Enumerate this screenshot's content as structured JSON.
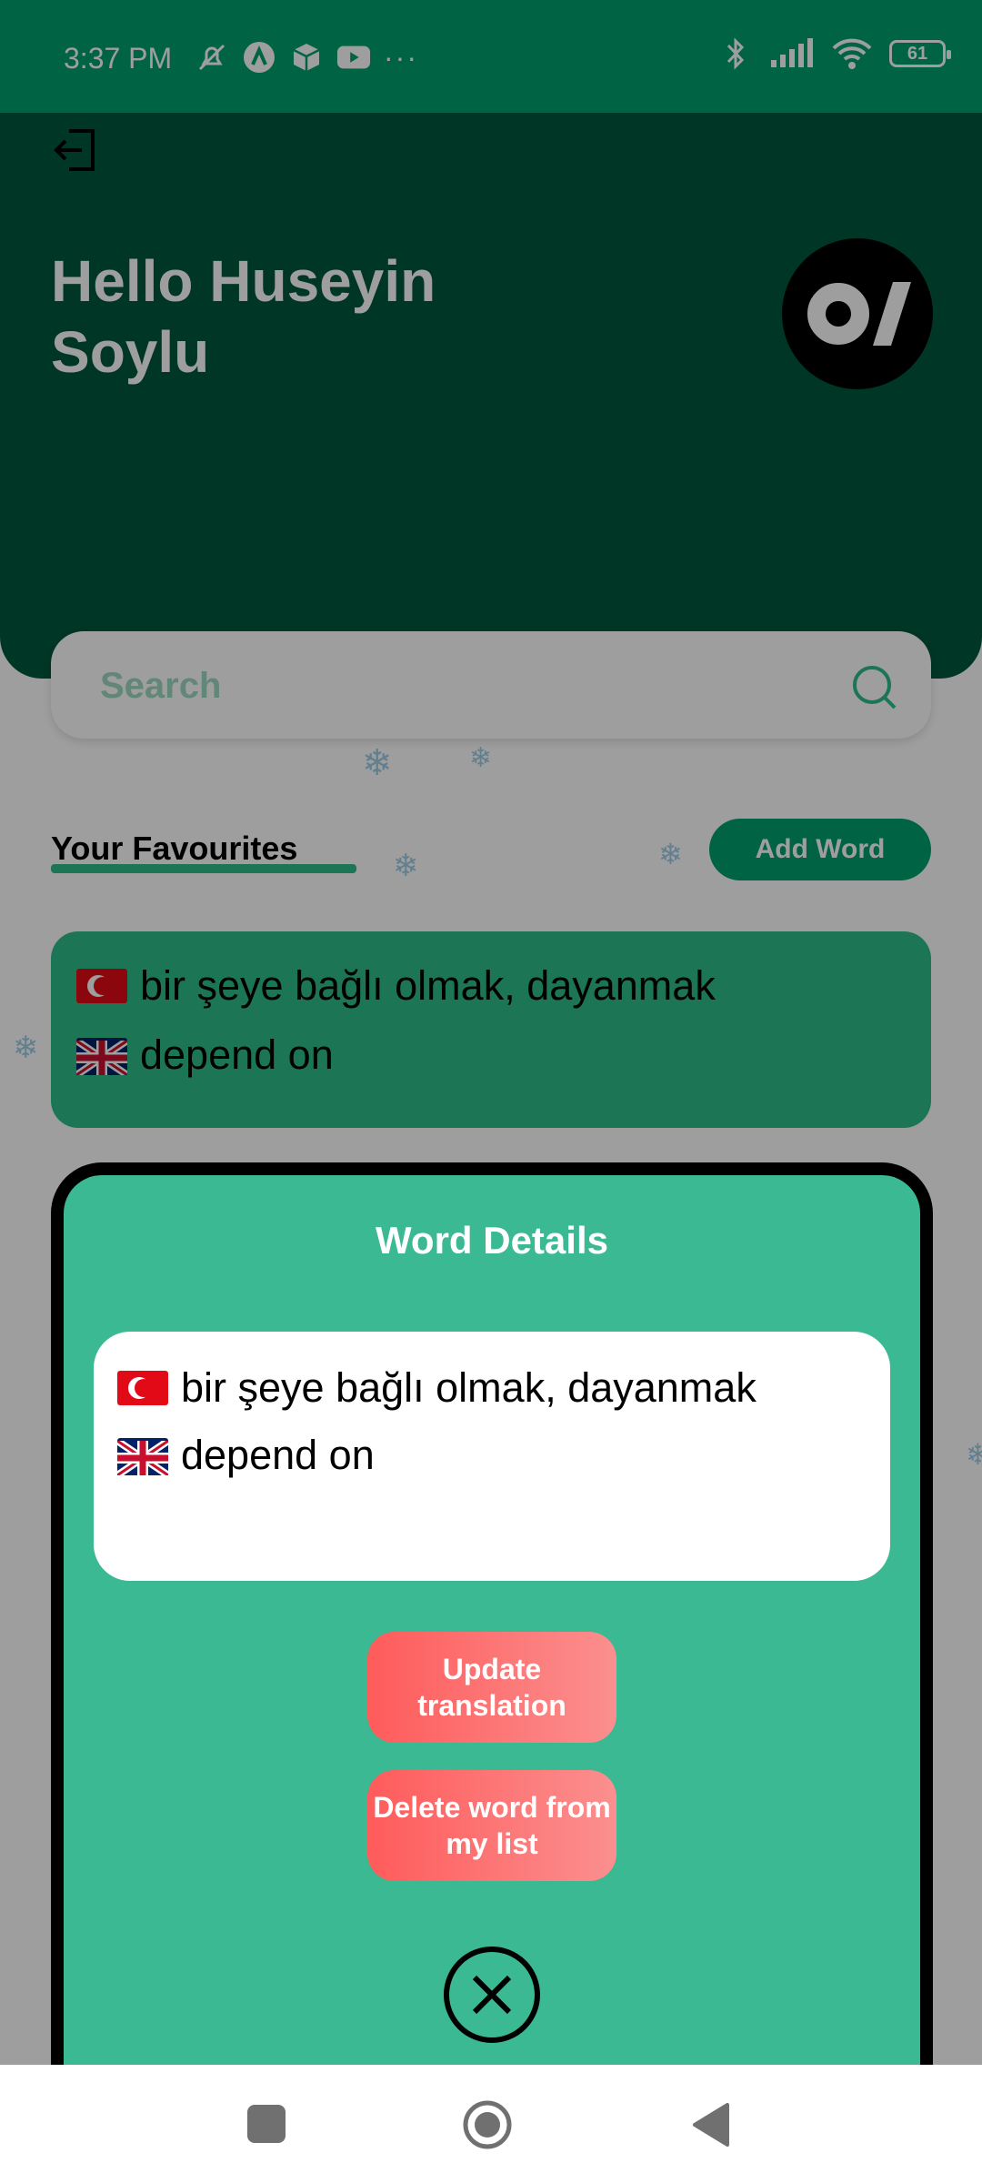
{
  "status_bar": {
    "time": "3:37 PM",
    "more": "···",
    "battery": "61"
  },
  "header": {
    "greeting": "Hello Huseyin Soylu"
  },
  "search": {
    "placeholder": "Search"
  },
  "favourites": {
    "title": "Your Favourites",
    "add_button": "Add Word",
    "items": [
      {
        "tr": "bir şeye bağlı olmak, dayanmak",
        "en": "depend on"
      }
    ]
  },
  "modal": {
    "title": "Word Details",
    "tr": "bir şeye bağlı olmak, dayanmak",
    "en": "depend on",
    "update_button": "Update translation",
    "delete_button": "Delete word from my list"
  },
  "colors": {
    "status_bar": "#00a26e",
    "header": "#00573c",
    "accent": "#2ebd88",
    "modal": "#3bb992",
    "danger": "#ff5b5b"
  },
  "icons": {
    "status": [
      "mute-icon",
      "app-a-icon",
      "box-icon",
      "youtube-icon",
      "bluetooth-icon",
      "signal-icon",
      "wifi-icon",
      "battery-icon"
    ],
    "header": [
      "logout-icon",
      "app-logo"
    ],
    "search": "search-icon",
    "modal": "close-circle-icon",
    "nav": [
      "recents-icon",
      "home-icon",
      "back-icon"
    ]
  }
}
